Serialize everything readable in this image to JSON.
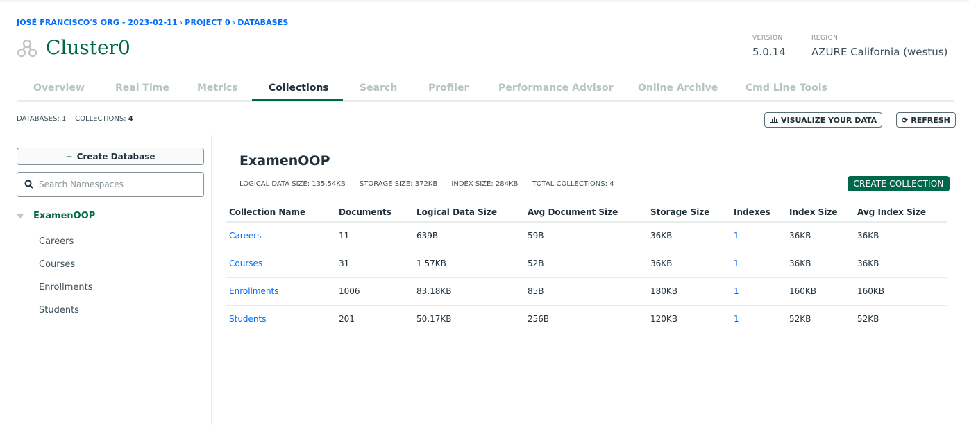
{
  "breadcrumb": {
    "org": "JOSÉ FRANCISCO'S ORG - 2023-02-11",
    "project": "PROJECT 0",
    "section": "DATABASES",
    "separator": "›"
  },
  "cluster": {
    "name": "Cluster0",
    "version_label": "VERSION",
    "version": "5.0.14",
    "region_label": "REGION",
    "region": "AZURE California (westus)"
  },
  "tabs": [
    {
      "label": "Overview"
    },
    {
      "label": "Real Time"
    },
    {
      "label": "Metrics"
    },
    {
      "label": "Collections"
    },
    {
      "label": "Search"
    },
    {
      "label": "Profiler"
    },
    {
      "label": "Performance Advisor"
    },
    {
      "label": "Online Archive"
    },
    {
      "label": "Cmd Line Tools"
    }
  ],
  "active_tab": "Collections",
  "summary": {
    "databases_label": "DATABASES:",
    "databases_value": "1",
    "collections_label": "COLLECTIONS:",
    "collections_value": "4"
  },
  "toolbar": {
    "visualize_label": "VISUALIZE YOUR DATA",
    "refresh_label": "REFRESH"
  },
  "sidebar": {
    "create_db_label": "Create Database",
    "search_placeholder": "Search Namespaces",
    "database": "ExamenOOP",
    "collections": [
      "Careers",
      "Courses",
      "Enrollments",
      "Students"
    ]
  },
  "main": {
    "db_title": "ExamenOOP",
    "stats": {
      "logical": "LOGICAL DATA SIZE: 135.54KB",
      "storage": "STORAGE SIZE: 372KB",
      "index": "INDEX SIZE: 284KB",
      "total": "TOTAL COLLECTIONS: 4"
    },
    "create_collection_label": "CREATE COLLECTION",
    "columns": [
      "Collection Name",
      "Documents",
      "Logical Data Size",
      "Avg Document Size",
      "Storage Size",
      "Indexes",
      "Index Size",
      "Avg Index Size"
    ],
    "rows": [
      [
        "Careers",
        "11",
        "639B",
        "59B",
        "36KB",
        "1",
        "36KB",
        "36KB"
      ],
      [
        "Courses",
        "31",
        "1.57KB",
        "52B",
        "36KB",
        "1",
        "36KB",
        "36KB"
      ],
      [
        "Enrollments",
        "1006",
        "83.18KB",
        "85B",
        "180KB",
        "1",
        "160KB",
        "160KB"
      ],
      [
        "Students",
        "201",
        "50.17KB",
        "256B",
        "120KB",
        "1",
        "52KB",
        "52KB"
      ]
    ]
  },
  "colors": {
    "brand_green": "#00684a",
    "link_blue": "#016bf8",
    "text": "#21313c",
    "muted": "#b8c4c2"
  }
}
